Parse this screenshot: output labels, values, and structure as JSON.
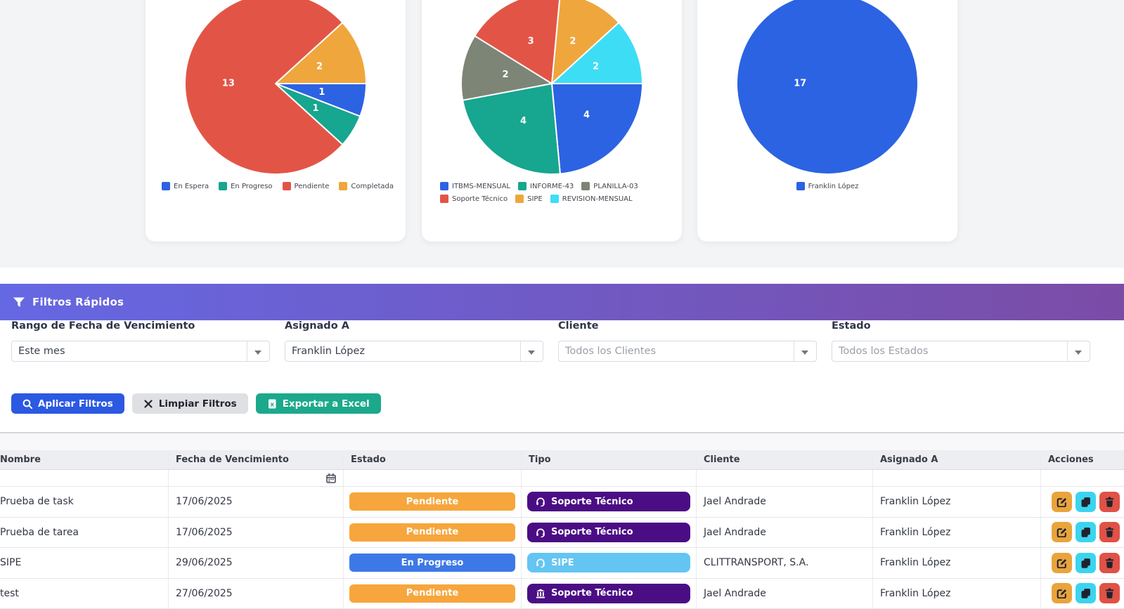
{
  "charts": [
    {
      "chart_id": "estado-distribution",
      "legend": [
        {
          "label": "En Espera",
          "color": "#2C63E2"
        },
        {
          "label": "En Progreso",
          "color": "#17A68F"
        },
        {
          "label": "Pendiente",
          "color": "#E25546"
        },
        {
          "label": "Completada",
          "color": "#EFA63D"
        }
      ]
    },
    {
      "chart_id": "tipo-distribution",
      "legend": [
        {
          "label": "ITBMS-MENSUAL",
          "color": "#2C63E2"
        },
        {
          "label": "INFORME-43",
          "color": "#17A68F"
        },
        {
          "label": "PLANILLA-03",
          "color": "#7D8577"
        },
        {
          "label": "Soporte Técnico",
          "color": "#E25546"
        },
        {
          "label": "SIPE",
          "color": "#EFA63D"
        },
        {
          "label": "REVISION-MENSUAL",
          "color": "#3EDDF6"
        }
      ]
    },
    {
      "chart_id": "asignado-distribution",
      "legend": [
        {
          "label": "Franklin López",
          "color": "#2C63E2"
        }
      ]
    }
  ],
  "chart_data": [
    {
      "type": "pie",
      "rotation": 47.65,
      "slices": [
        {
          "label": "Completada",
          "value": 2,
          "color": "#EFA63D"
        },
        {
          "label": "En Espera",
          "value": 1,
          "color": "#2C63E2"
        },
        {
          "label": "En Progreso",
          "value": 1,
          "color": "#17A68F"
        },
        {
          "label": "Pendiente",
          "value": 13,
          "color": "#E25546"
        }
      ]
    },
    {
      "type": "pie",
      "rotation": 5.3,
      "slices": [
        {
          "label": "SIPE",
          "value": 2,
          "color": "#EFA63D"
        },
        {
          "label": "REVISION-MENSUAL",
          "value": 2,
          "color": "#3EDDF6"
        },
        {
          "label": "ITBMS-MENSUAL",
          "value": 4,
          "color": "#2C63E2"
        },
        {
          "label": "INFORME-43",
          "value": 4,
          "color": "#17A68F"
        },
        {
          "label": "PLANILLA-03",
          "value": 2,
          "color": "#7D8577"
        },
        {
          "label": "Soporte Técnico",
          "value": 3,
          "color": "#E25546"
        }
      ]
    },
    {
      "type": "pie",
      "rotation": 0,
      "label_angle": 270,
      "label_radius": 0.3,
      "slices": [
        {
          "label": "Franklin López",
          "value": 17,
          "color": "#2C63E2"
        }
      ]
    }
  ],
  "filters": {
    "header": {
      "title": "Filtros Rápidos"
    },
    "fields": [
      {
        "label": "Rango de Fecha de Vencimiento",
        "value": "Este mes",
        "muted": false
      },
      {
        "label": "Asignado A",
        "value": "Franklin López",
        "muted": false
      },
      {
        "label": "Cliente",
        "value": "Todos los Clientes",
        "muted": true
      },
      {
        "label": "Estado",
        "value": "Todos los Estados",
        "muted": true
      }
    ],
    "buttons": [
      {
        "id": "apply",
        "label": "Aplicar Filtros",
        "icon": "search-icon",
        "bg": "#2B59E2",
        "fg": "#ffffff"
      },
      {
        "id": "clear",
        "label": "Limpiar Filtros",
        "icon": "x-icon",
        "bg": "#dfe0e3",
        "fg": "#22262e"
      },
      {
        "id": "export",
        "label": "Exportar a Excel",
        "icon": "excel-icon",
        "bg": "#1CA98B",
        "fg": "#ffffff"
      }
    ]
  },
  "table": {
    "columns": [
      "Nombre",
      "Fecha de Vencimiento",
      "Estado",
      "Tipo",
      "Cliente",
      "Asignado A",
      "Acciones"
    ],
    "rows": [
      {
        "nombre": "Prueba de task",
        "fecha": "17/06/2025",
        "estado": {
          "label": "Pendiente",
          "color": "#F6A63C"
        },
        "tipo": {
          "label": "Soporte Técnico",
          "color": "#4B0D84",
          "icon": "headset-icon"
        },
        "cliente": "Jael Andrade",
        "asignado": "Franklin López"
      },
      {
        "nombre": "Prueba de tarea",
        "fecha": "17/06/2025",
        "estado": {
          "label": "Pendiente",
          "color": "#F6A63C"
        },
        "tipo": {
          "label": "Soporte Técnico",
          "color": "#4B0D84",
          "icon": "headset-icon"
        },
        "cliente": "Jael Andrade",
        "asignado": "Franklin López"
      },
      {
        "nombre": "SIPE",
        "fecha": "29/06/2025",
        "estado": {
          "label": "En Progreso",
          "color": "#3D79E6"
        },
        "tipo": {
          "label": "SIPE",
          "color": "#64C5F2",
          "icon": "headset-icon"
        },
        "cliente": "CLITTRANSPORT, S.A.",
        "asignado": "Franklin López"
      },
      {
        "nombre": "test",
        "fecha": "27/06/2025",
        "estado": {
          "label": "Pendiente",
          "color": "#F6A63C"
        },
        "tipo": {
          "label": "Soporte Técnico",
          "color": "#4B0D84",
          "icon": "building-icon"
        },
        "cliente": "Jael Andrade",
        "asignado": "Franklin López"
      }
    ],
    "actions": [
      {
        "id": "edit",
        "icon": "edit-icon",
        "bg": "#E9A43C"
      },
      {
        "id": "copy",
        "icon": "copy-icon",
        "bg": "#3BD4EF"
      },
      {
        "id": "delete",
        "icon": "trash-icon",
        "bg": "#E05146"
      }
    ]
  }
}
